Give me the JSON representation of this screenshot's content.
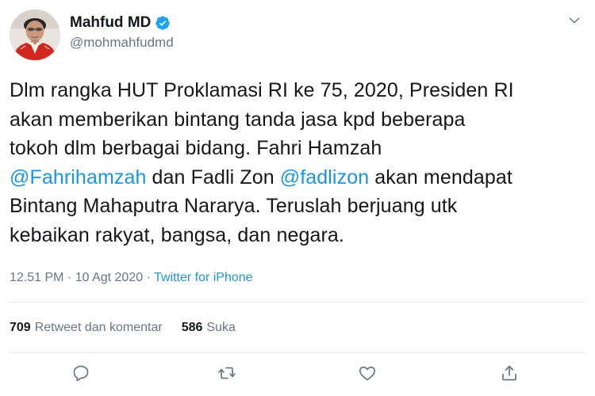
{
  "user": {
    "display_name": "Mahfud MD",
    "handle": "@mohmahfudmd",
    "verified": true
  },
  "tweet": {
    "lines": [
      [
        {
          "t": "Dlm rangka HUT Proklamasi RI ke 75, 2020, Presiden RI"
        }
      ],
      [
        {
          "t": "akan memberikan bintang tanda jasa kpd beberapa"
        }
      ],
      [
        {
          "t": "tokoh dlm berbagai bidang. Fahri Hamzah"
        }
      ],
      [
        {
          "t": "@Fahrihamzah",
          "mention": true
        },
        {
          "t": " dan Fadli Zon "
        },
        {
          "t": "@fadlizon",
          "mention": true
        },
        {
          "t": " akan mendapat"
        }
      ],
      [
        {
          "t": "Bintang Mahaputra Nararya. Teruslah berjuang utk"
        }
      ],
      [
        {
          "t": "kebaikan rakyat, bangsa, dan negara."
        }
      ]
    ]
  },
  "meta": {
    "time": "12.51 PM",
    "separator": " · ",
    "date": "10 Agt 2020",
    "source": "Twitter for iPhone"
  },
  "stats": {
    "retweets_count": "709",
    "retweets_label": "Retweet dan komentar",
    "likes_count": "586",
    "likes_label": "Suka"
  },
  "icons": {
    "verified": "verified-badge-icon",
    "more": "chevron-down-icon",
    "reply": "reply-icon",
    "retweet": "retweet-icon",
    "like": "heart-icon",
    "share": "share-icon"
  },
  "colors": {
    "link": "#1b95e0",
    "secondary_text": "#657786",
    "primary_text": "#14171a",
    "divider": "#e6ecf0"
  }
}
